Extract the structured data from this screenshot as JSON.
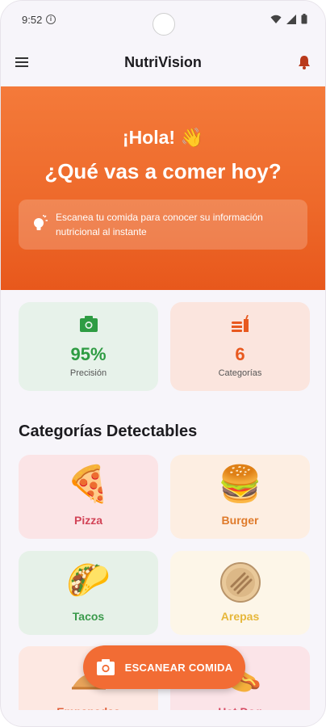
{
  "status_bar": {
    "time": "9:52"
  },
  "app_bar": {
    "title": "NutriVision"
  },
  "hero": {
    "greeting": "¡Hola! 👋",
    "question": "¿Qué vas a comer hoy?",
    "tip": "Escanea tu comida para conocer su información nutricional al instante"
  },
  "stats": [
    {
      "value": "95%",
      "label": "Precisión",
      "icon": "camera-icon"
    },
    {
      "value": "6",
      "label": "Categorías",
      "icon": "fastfood-icon"
    }
  ],
  "section_title": "Categorías Detectables",
  "categories": [
    {
      "label": "Pizza",
      "emoji": "🍕"
    },
    {
      "label": "Burger",
      "emoji": "🍔"
    },
    {
      "label": "Tacos",
      "emoji": "🌮"
    },
    {
      "label": "Arepas",
      "emoji": ""
    },
    {
      "label": "Empanadas",
      "emoji": ""
    },
    {
      "label": "Hot Dog",
      "emoji": "🌭"
    }
  ],
  "fab": {
    "label": "ESCANEAR COMIDA",
    "icon": "camera-icon"
  },
  "colors": {
    "primary": "#f26c34",
    "success": "#2e9c43"
  }
}
